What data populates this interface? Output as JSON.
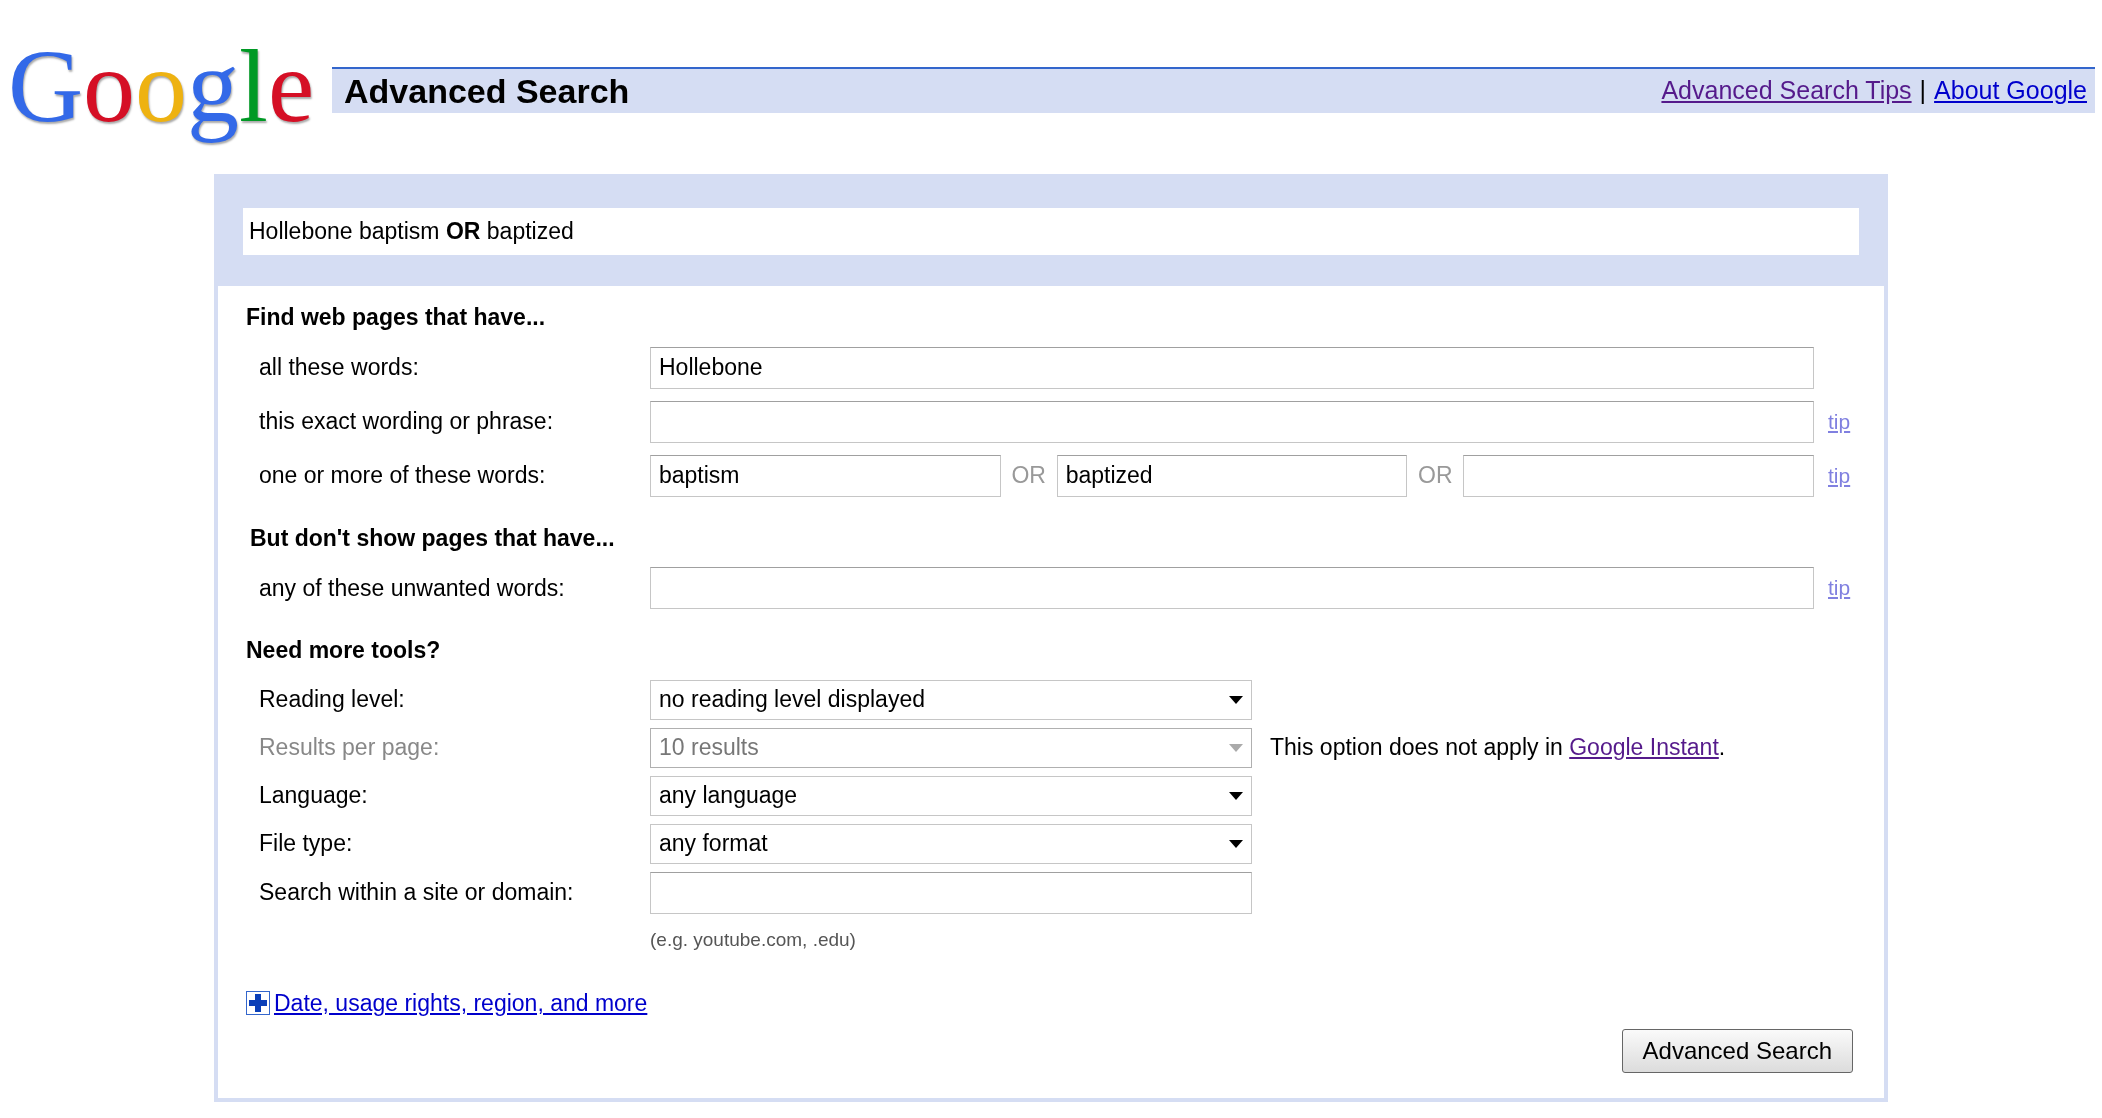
{
  "logo": {
    "text": "Google"
  },
  "header": {
    "title": "Advanced Search",
    "links": [
      "Advanced Search Tips",
      "About Google"
    ],
    "separator": "|"
  },
  "query": "Hollebone baptism **OR** baptized",
  "sections": [
    {
      "heading": "Find web pages that have...",
      "rows": [
        {
          "kind": "text",
          "label": "all these words:",
          "value": "Hollebone"
        },
        {
          "kind": "text",
          "label": "this exact wording or phrase:",
          "tip": "tip"
        },
        {
          "kind": "or",
          "label": "one or more of these words:",
          "values": [
            "baptism",
            "baptized"
          ],
          "separators": [
            "OR",
            "OR"
          ],
          "tip": "tip"
        }
      ]
    },
    {
      "heading": "But don't show pages that have...",
      "rows": [
        {
          "kind": "text",
          "label": "any of these unwanted words:",
          "tip": "tip"
        }
      ]
    },
    {
      "heading": "Need more tools?",
      "rows": [
        {
          "kind": "select",
          "label": "Reading level:",
          "value": "no reading level displayed",
          "disabled": false
        },
        {
          "kind": "select",
          "label": "Results per page:",
          "value": "10 results",
          "disabled": true,
          "note": "This option does not apply in ",
          "note_link": "Google Instant",
          "note_end": "."
        },
        {
          "kind": "select",
          "label": "Language:",
          "value": "any language",
          "disabled": false
        },
        {
          "kind": "select",
          "label": "File type:",
          "value": "any format",
          "disabled": false
        },
        {
          "kind": "text",
          "label": "Search within a site or domain:",
          "hint": "(e.g. youtube.com, .edu)"
        }
      ]
    }
  ],
  "more_link": "Date, usage rights, region, and more",
  "button": "Advanced Search"
}
